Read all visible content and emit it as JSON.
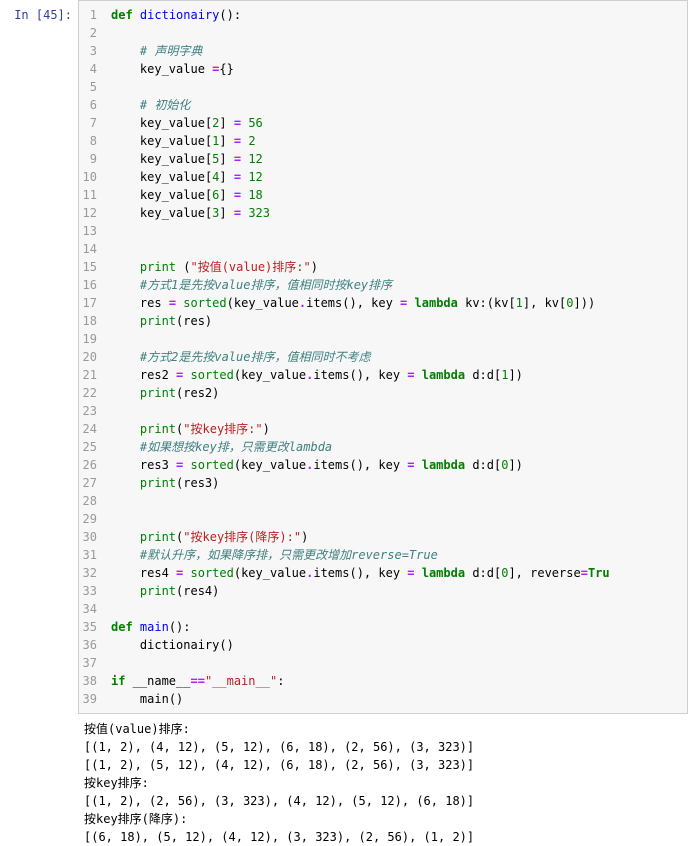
{
  "prompt": "In [45]:",
  "lines": [
    {
      "n": "1",
      "tokens": [
        {
          "c": "kw",
          "t": "def"
        },
        {
          "c": "pn",
          "t": " "
        },
        {
          "c": "fn",
          "t": "dictionairy"
        },
        {
          "c": "pn",
          "t": "():"
        }
      ]
    },
    {
      "n": "2",
      "tokens": []
    },
    {
      "n": "3",
      "tokens": [
        {
          "c": "pn",
          "t": "    "
        },
        {
          "c": "cmt",
          "t": "# 声明字典"
        }
      ]
    },
    {
      "n": "4",
      "tokens": [
        {
          "c": "pn",
          "t": "    "
        },
        {
          "c": "nm",
          "t": "key_value "
        },
        {
          "c": "op",
          "t": "="
        },
        {
          "c": "pn",
          "t": "{}"
        }
      ]
    },
    {
      "n": "5",
      "tokens": []
    },
    {
      "n": "6",
      "tokens": [
        {
          "c": "pn",
          "t": "    "
        },
        {
          "c": "cmt",
          "t": "# 初始化"
        }
      ]
    },
    {
      "n": "7",
      "tokens": [
        {
          "c": "pn",
          "t": "    "
        },
        {
          "c": "nm",
          "t": "key_value"
        },
        {
          "c": "pn",
          "t": "["
        },
        {
          "c": "num",
          "t": "2"
        },
        {
          "c": "pn",
          "t": "] "
        },
        {
          "c": "op",
          "t": "="
        },
        {
          "c": "pn",
          "t": " "
        },
        {
          "c": "num",
          "t": "56"
        }
      ]
    },
    {
      "n": "8",
      "tokens": [
        {
          "c": "pn",
          "t": "    "
        },
        {
          "c": "nm",
          "t": "key_value"
        },
        {
          "c": "pn",
          "t": "["
        },
        {
          "c": "num",
          "t": "1"
        },
        {
          "c": "pn",
          "t": "] "
        },
        {
          "c": "op",
          "t": "="
        },
        {
          "c": "pn",
          "t": " "
        },
        {
          "c": "num",
          "t": "2"
        }
      ]
    },
    {
      "n": "9",
      "tokens": [
        {
          "c": "pn",
          "t": "    "
        },
        {
          "c": "nm",
          "t": "key_value"
        },
        {
          "c": "pn",
          "t": "["
        },
        {
          "c": "num",
          "t": "5"
        },
        {
          "c": "pn",
          "t": "] "
        },
        {
          "c": "op",
          "t": "="
        },
        {
          "c": "pn",
          "t": " "
        },
        {
          "c": "num",
          "t": "12"
        }
      ]
    },
    {
      "n": "10",
      "tokens": [
        {
          "c": "pn",
          "t": "    "
        },
        {
          "c": "nm",
          "t": "key_value"
        },
        {
          "c": "pn",
          "t": "["
        },
        {
          "c": "num",
          "t": "4"
        },
        {
          "c": "pn",
          "t": "] "
        },
        {
          "c": "op",
          "t": "="
        },
        {
          "c": "pn",
          "t": " "
        },
        {
          "c": "num",
          "t": "12"
        }
      ]
    },
    {
      "n": "11",
      "tokens": [
        {
          "c": "pn",
          "t": "    "
        },
        {
          "c": "nm",
          "t": "key_value"
        },
        {
          "c": "pn",
          "t": "["
        },
        {
          "c": "num",
          "t": "6"
        },
        {
          "c": "pn",
          "t": "] "
        },
        {
          "c": "op",
          "t": "="
        },
        {
          "c": "pn",
          "t": " "
        },
        {
          "c": "num",
          "t": "18"
        }
      ]
    },
    {
      "n": "12",
      "tokens": [
        {
          "c": "pn",
          "t": "    "
        },
        {
          "c": "nm",
          "t": "key_value"
        },
        {
          "c": "pn",
          "t": "["
        },
        {
          "c": "num",
          "t": "3"
        },
        {
          "c": "pn",
          "t": "] "
        },
        {
          "c": "op",
          "t": "="
        },
        {
          "c": "pn",
          "t": " "
        },
        {
          "c": "num",
          "t": "323"
        }
      ]
    },
    {
      "n": "13",
      "tokens": []
    },
    {
      "n": "14",
      "tokens": []
    },
    {
      "n": "15",
      "tokens": [
        {
          "c": "pn",
          "t": "    "
        },
        {
          "c": "bi",
          "t": "print"
        },
        {
          "c": "pn",
          "t": " ("
        },
        {
          "c": "str",
          "t": "\"按值(value)排序:\""
        },
        {
          "c": "pn",
          "t": ")"
        }
      ]
    },
    {
      "n": "16",
      "tokens": [
        {
          "c": "pn",
          "t": "    "
        },
        {
          "c": "cmt",
          "t": "#方式1是先按value排序，值相同时按key排序"
        }
      ]
    },
    {
      "n": "17",
      "tokens": [
        {
          "c": "pn",
          "t": "    "
        },
        {
          "c": "nm",
          "t": "res "
        },
        {
          "c": "op",
          "t": "="
        },
        {
          "c": "pn",
          "t": " "
        },
        {
          "c": "bi",
          "t": "sorted"
        },
        {
          "c": "pn",
          "t": "(key_value"
        },
        {
          "c": "op",
          "t": "."
        },
        {
          "c": "nm",
          "t": "items"
        },
        {
          "c": "pn",
          "t": "(), key "
        },
        {
          "c": "op",
          "t": "="
        },
        {
          "c": "pn",
          "t": " "
        },
        {
          "c": "kw",
          "t": "lambda"
        },
        {
          "c": "pn",
          "t": " kv:(kv["
        },
        {
          "c": "num",
          "t": "1"
        },
        {
          "c": "pn",
          "t": "], kv["
        },
        {
          "c": "num",
          "t": "0"
        },
        {
          "c": "pn",
          "t": "]))"
        }
      ]
    },
    {
      "n": "18",
      "tokens": [
        {
          "c": "pn",
          "t": "    "
        },
        {
          "c": "bi",
          "t": "print"
        },
        {
          "c": "pn",
          "t": "(res)"
        }
      ]
    },
    {
      "n": "19",
      "tokens": []
    },
    {
      "n": "20",
      "tokens": [
        {
          "c": "pn",
          "t": "    "
        },
        {
          "c": "cmt",
          "t": "#方式2是先按value排序，值相同时不考虑"
        }
      ]
    },
    {
      "n": "21",
      "tokens": [
        {
          "c": "pn",
          "t": "    "
        },
        {
          "c": "nm",
          "t": "res2 "
        },
        {
          "c": "op",
          "t": "="
        },
        {
          "c": "pn",
          "t": " "
        },
        {
          "c": "bi",
          "t": "sorted"
        },
        {
          "c": "pn",
          "t": "(key_value"
        },
        {
          "c": "op",
          "t": "."
        },
        {
          "c": "nm",
          "t": "items"
        },
        {
          "c": "pn",
          "t": "(), key "
        },
        {
          "c": "op",
          "t": "="
        },
        {
          "c": "pn",
          "t": " "
        },
        {
          "c": "kw",
          "t": "lambda"
        },
        {
          "c": "pn",
          "t": " d:d["
        },
        {
          "c": "num",
          "t": "1"
        },
        {
          "c": "pn",
          "t": "])"
        }
      ]
    },
    {
      "n": "22",
      "tokens": [
        {
          "c": "pn",
          "t": "    "
        },
        {
          "c": "bi",
          "t": "print"
        },
        {
          "c": "pn",
          "t": "(res2)"
        }
      ]
    },
    {
      "n": "23",
      "tokens": []
    },
    {
      "n": "24",
      "tokens": [
        {
          "c": "pn",
          "t": "    "
        },
        {
          "c": "bi",
          "t": "print"
        },
        {
          "c": "pn",
          "t": "("
        },
        {
          "c": "str",
          "t": "\"按key排序:\""
        },
        {
          "c": "pn",
          "t": ")"
        }
      ]
    },
    {
      "n": "25",
      "tokens": [
        {
          "c": "pn",
          "t": "    "
        },
        {
          "c": "cmt",
          "t": "#如果想按key排，只需更改lambda"
        }
      ]
    },
    {
      "n": "26",
      "tokens": [
        {
          "c": "pn",
          "t": "    "
        },
        {
          "c": "nm",
          "t": "res3 "
        },
        {
          "c": "op",
          "t": "="
        },
        {
          "c": "pn",
          "t": " "
        },
        {
          "c": "bi",
          "t": "sorted"
        },
        {
          "c": "pn",
          "t": "(key_value"
        },
        {
          "c": "op",
          "t": "."
        },
        {
          "c": "nm",
          "t": "items"
        },
        {
          "c": "pn",
          "t": "(), key "
        },
        {
          "c": "op",
          "t": "="
        },
        {
          "c": "pn",
          "t": " "
        },
        {
          "c": "kw",
          "t": "lambda"
        },
        {
          "c": "pn",
          "t": " d:d["
        },
        {
          "c": "num",
          "t": "0"
        },
        {
          "c": "pn",
          "t": "])"
        }
      ]
    },
    {
      "n": "27",
      "tokens": [
        {
          "c": "pn",
          "t": "    "
        },
        {
          "c": "bi",
          "t": "print"
        },
        {
          "c": "pn",
          "t": "(res3)"
        }
      ]
    },
    {
      "n": "28",
      "tokens": []
    },
    {
      "n": "29",
      "tokens": []
    },
    {
      "n": "30",
      "tokens": [
        {
          "c": "pn",
          "t": "    "
        },
        {
          "c": "bi",
          "t": "print"
        },
        {
          "c": "pn",
          "t": "("
        },
        {
          "c": "str",
          "t": "\"按key排序(降序):\""
        },
        {
          "c": "pn",
          "t": ")"
        }
      ]
    },
    {
      "n": "31",
      "tokens": [
        {
          "c": "pn",
          "t": "    "
        },
        {
          "c": "cmt",
          "t": "#默认升序，如果降序排，只需更改增加reverse=True"
        }
      ]
    },
    {
      "n": "32",
      "tokens": [
        {
          "c": "pn",
          "t": "    "
        },
        {
          "c": "nm",
          "t": "res4 "
        },
        {
          "c": "op",
          "t": "="
        },
        {
          "c": "pn",
          "t": " "
        },
        {
          "c": "bi",
          "t": "sorted"
        },
        {
          "c": "pn",
          "t": "(key_value"
        },
        {
          "c": "op",
          "t": "."
        },
        {
          "c": "nm",
          "t": "items"
        },
        {
          "c": "pn",
          "t": "(), key "
        },
        {
          "c": "op",
          "t": "="
        },
        {
          "c": "pn",
          "t": " "
        },
        {
          "c": "kw",
          "t": "lambda"
        },
        {
          "c": "pn",
          "t": " d:d["
        },
        {
          "c": "num",
          "t": "0"
        },
        {
          "c": "pn",
          "t": "], reverse"
        },
        {
          "c": "op",
          "t": "="
        },
        {
          "c": "kw",
          "t": "Tru"
        }
      ]
    },
    {
      "n": "33",
      "tokens": [
        {
          "c": "pn",
          "t": "    "
        },
        {
          "c": "bi",
          "t": "print"
        },
        {
          "c": "pn",
          "t": "(res4)"
        }
      ]
    },
    {
      "n": "34",
      "tokens": []
    },
    {
      "n": "35",
      "tokens": [
        {
          "c": "kw",
          "t": "def"
        },
        {
          "c": "pn",
          "t": " "
        },
        {
          "c": "fn",
          "t": "main"
        },
        {
          "c": "pn",
          "t": "():"
        }
      ]
    },
    {
      "n": "36",
      "tokens": [
        {
          "c": "pn",
          "t": "    "
        },
        {
          "c": "nm",
          "t": "dictionairy"
        },
        {
          "c": "pn",
          "t": "()"
        }
      ]
    },
    {
      "n": "37",
      "tokens": []
    },
    {
      "n": "38",
      "tokens": [
        {
          "c": "kw",
          "t": "if"
        },
        {
          "c": "pn",
          "t": " __name__"
        },
        {
          "c": "op",
          "t": "=="
        },
        {
          "c": "str",
          "t": "\"__main__\""
        },
        {
          "c": "pn",
          "t": ":"
        }
      ]
    },
    {
      "n": "39",
      "tokens": [
        {
          "c": "pn",
          "t": "    "
        },
        {
          "c": "nm",
          "t": "main"
        },
        {
          "c": "pn",
          "t": "()"
        }
      ]
    }
  ],
  "output": [
    "按值(value)排序:",
    "[(1, 2), (4, 12), (5, 12), (6, 18), (2, 56), (3, 323)]",
    "[(1, 2), (5, 12), (4, 12), (6, 18), (2, 56), (3, 323)]",
    "按key排序:",
    "[(1, 2), (2, 56), (3, 323), (4, 12), (5, 12), (6, 18)]",
    "按key排序(降序):",
    "[(6, 18), (5, 12), (4, 12), (3, 323), (2, 56), (1, 2)]"
  ]
}
